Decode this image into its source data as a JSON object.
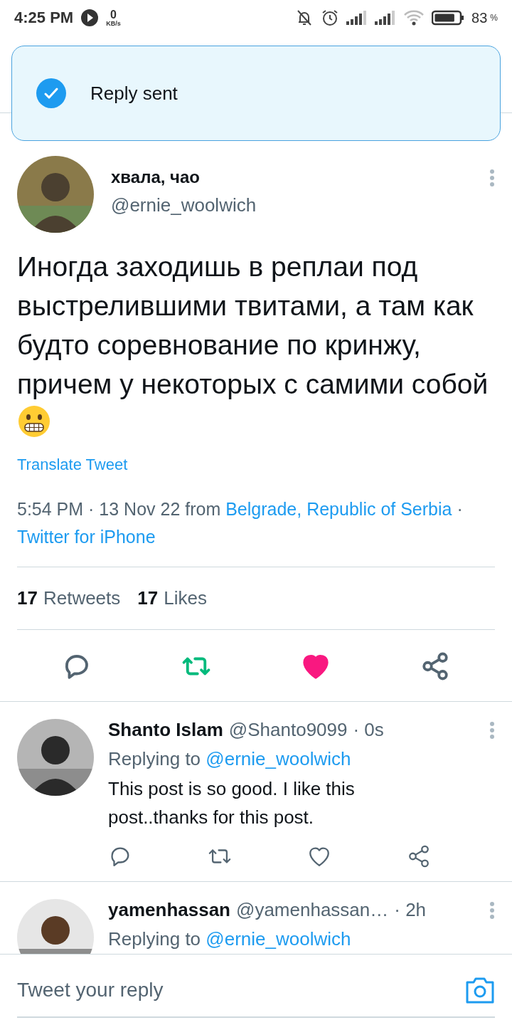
{
  "status_bar": {
    "time": "4:25 PM",
    "net_speed": "0",
    "net_unit": "KB/s",
    "battery": "83",
    "battery_unit": "%"
  },
  "toast": {
    "text": "Reply sent"
  },
  "tweet": {
    "name": "хвала, чао",
    "handle": "@ernie_woolwich",
    "text": "Иногда заходишь в реплаи под выстрелившими твитами, а там как будто соревнование по кринжу, причем у некоторых с самими собой",
    "translate": "Translate Tweet",
    "date": "5:54 PM · 13 Nov 22 from",
    "location": "Belgrade, Republic of Serbia",
    "separator": "·",
    "source": "Twitter for iPhone",
    "stats": [
      {
        "count": "17",
        "label": "Retweets"
      },
      {
        "count": "17",
        "label": "Likes"
      }
    ],
    "retweeted": true,
    "liked": true
  },
  "replies": [
    {
      "name": "Shanto Islam",
      "handle": "@Shanto9099",
      "time": "· 0s",
      "replying_label": "Replying to",
      "replying_handle": "@ernie_woolwich",
      "text": "This post is so good. I like this post..thanks for this post.",
      "retweeted": false,
      "liked": false
    },
    {
      "name": "yamenhassan",
      "handle": "@yamenhassan…",
      "time": "· 2h",
      "replying_label": "Replying to",
      "replying_handle": "@ernie_woolwich"
    }
  ],
  "compose": {
    "placeholder": "Tweet your reply"
  }
}
